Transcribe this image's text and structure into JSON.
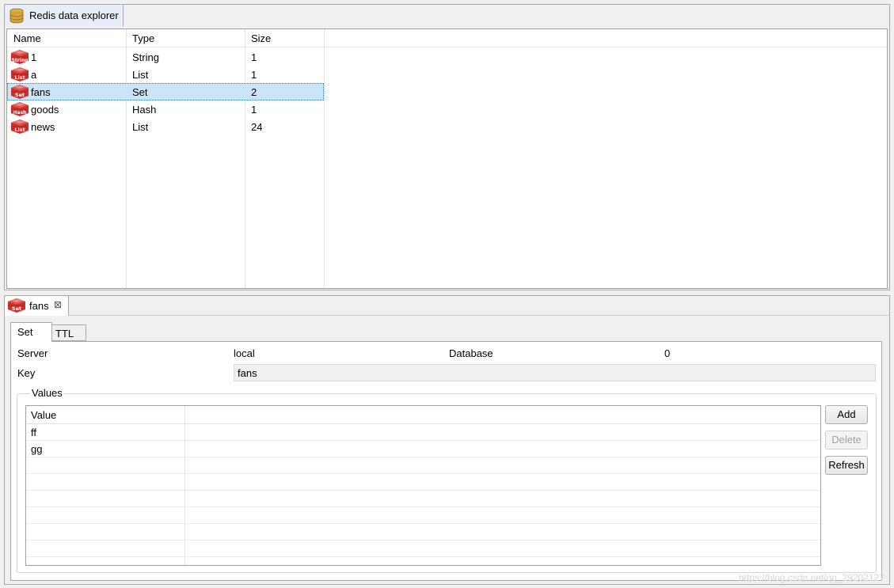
{
  "explorer": {
    "tab_label": "Redis data explorer",
    "columns": [
      "Name",
      "Type",
      "Size"
    ],
    "rows": [
      {
        "icon": "String",
        "name": "1",
        "type": "String",
        "size": "1"
      },
      {
        "icon": "List",
        "name": "a",
        "type": "List",
        "size": "1"
      },
      {
        "icon": "Set",
        "name": "fans",
        "type": "Set",
        "size": "2",
        "selected": true
      },
      {
        "icon": "Hash",
        "name": "goods",
        "type": "Hash",
        "size": "1"
      },
      {
        "icon": "List",
        "name": "news",
        "type": "List",
        "size": "24"
      }
    ]
  },
  "editor": {
    "tab_icon": "Set",
    "tab_label": "fans",
    "close_glyph": "⊠",
    "subtabs": [
      "Set",
      "TTL"
    ],
    "server_label": "Server",
    "server_value": "local",
    "database_label": "Database",
    "database_value": "0",
    "key_label": "Key",
    "key_value": "fans",
    "values_group_label": "Values",
    "values_column": "Value",
    "values": [
      "ff",
      "gg"
    ],
    "buttons": {
      "add": "Add",
      "delete": "Delete",
      "refresh": "Refresh"
    }
  },
  "watermark": "https://blog.csdn.net/qq_29202127",
  "colors": {
    "accent_selection": "#cce4f7",
    "redis_red": "#c9302c"
  }
}
